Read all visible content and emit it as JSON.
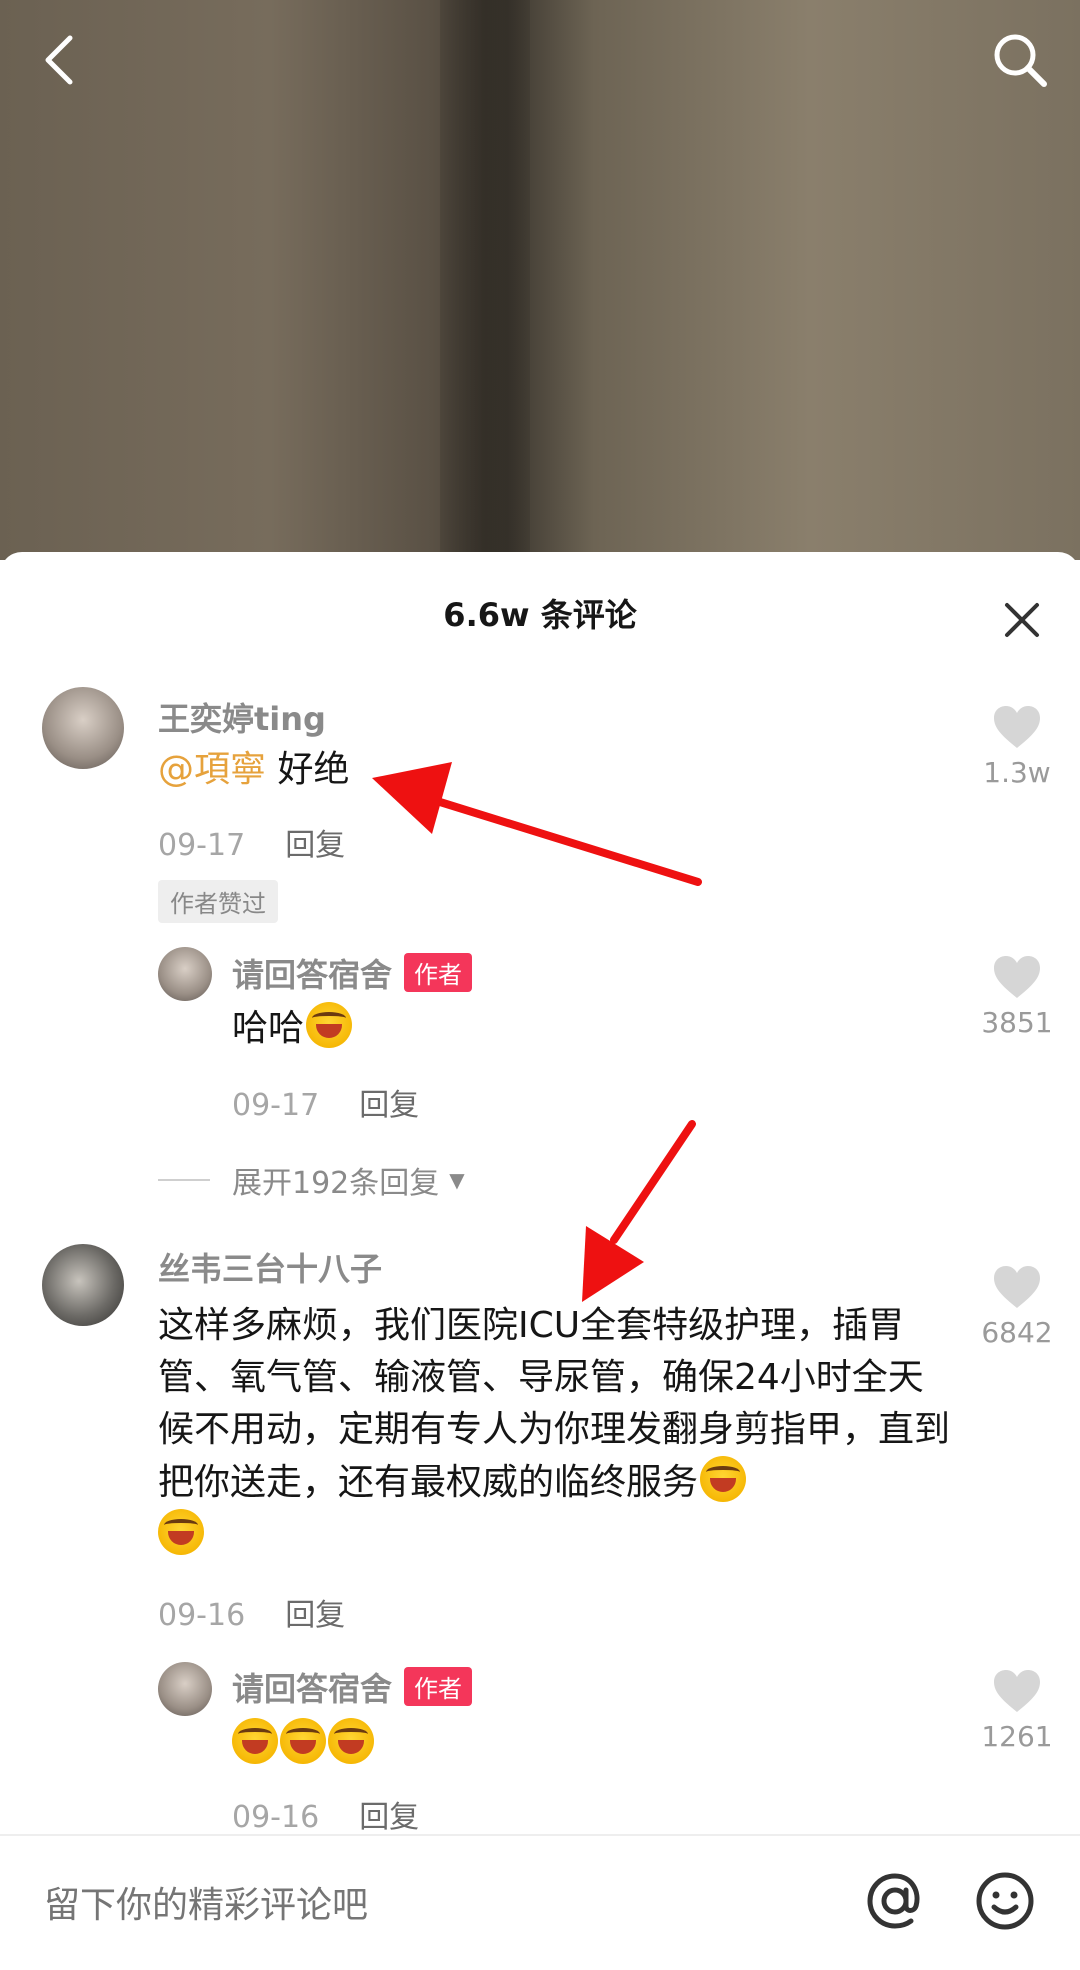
{
  "sheet": {
    "title": "6.6w 条评论"
  },
  "comments": [
    {
      "username": "王奕婷ting",
      "mention": "@項寧",
      "text": " 好绝",
      "date": "09-17",
      "reply_label": "回复",
      "liked_tag": "作者赞过",
      "likes": "1.3w"
    },
    {
      "username": "丝韦三台十八子",
      "text": "这样多麻烦，我们医院ICU全套特级护理，插胃管、氧气管、输液管、导尿管，确保24小时全天候不用动，定期有专人为你理发翻身剪指甲，直到把你送走，还有最权威的临终服务",
      "date": "09-16",
      "reply_label": "回复",
      "likes": "6842"
    }
  ],
  "replies": [
    {
      "username": "请回答宿舍",
      "badge": "作者",
      "text": "哈哈",
      "date": "09-17",
      "reply_label": "回复",
      "likes": "3851"
    },
    {
      "username": "请回答宿舍",
      "badge": "作者",
      "text": "",
      "date": "09-16",
      "reply_label": "回复",
      "likes": "1261"
    }
  ],
  "expand_label": "展开192条回复",
  "input": {
    "placeholder": "留下你的精彩评论吧"
  },
  "colors": {
    "mention": "#e6a23c",
    "author_badge": "#f4365a",
    "arrow": "#ee1111"
  },
  "icons": [
    "back-icon",
    "search-icon",
    "close-icon",
    "heart-icon",
    "at-icon",
    "smile-icon",
    "laugh-cry-emoji"
  ]
}
